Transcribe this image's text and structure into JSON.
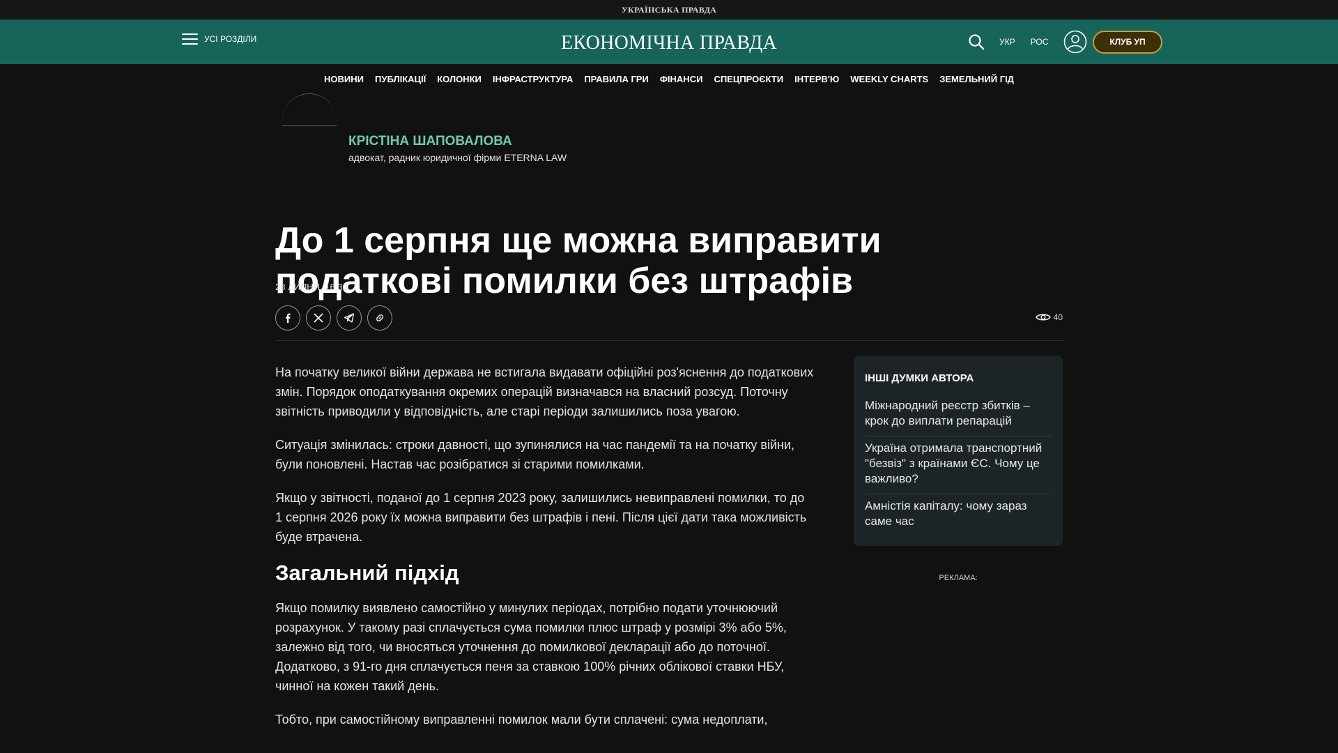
{
  "topbar": {
    "brand": "УКРАЇНСЬКА ПРАВДА"
  },
  "header": {
    "menu_label": "УСІ РОЗДІЛИ",
    "logo": "ЕКОНОМІЧНА ПРАВДА",
    "lang_ukr": "УКР",
    "lang_ros": "РОС",
    "club_label": "КЛУБ УП"
  },
  "nav": {
    "items": [
      "НОВИНИ",
      "ПУБЛІКАЦІЇ",
      "КОЛОНКИ",
      "ІНФРАСТРУКТУРА",
      "ПРАВИЛА ГРИ",
      "ФІНАНСИ",
      "СПЕЦПРОЄКТИ",
      "ІНТЕРВ'Ю",
      "WEEKLY CHARTS",
      "ЗЕМЕЛЬНИЙ ГІД"
    ]
  },
  "author": {
    "name": "КРІСТІНА ШАПОВАЛОВА",
    "role": "адвокат, радник юридичної фірми ETERNA LAW"
  },
  "article": {
    "title": "До 1 серпня ще можна виправити податкові помилки без штрафів",
    "date": "28 ЛИПНЯ, 16:30",
    "views": "40",
    "p1": "На початку великої війни держава не встигала видавати офіційні роз'яснення до податкових змін. Порядок оподаткування окремих операцій визначався на власний розсуд. Поточну звітність приводили у відповідність, але старі періоди залишились поза увагою.",
    "p2": "Ситуація змінилась: строки давності, що зупинялися на час пандемії та на початку війни, були поновлені. Настав час розібратися зі старими помилками.",
    "p3": "Якщо у звітності, поданої до 1 серпня 2023 року, залишились невиправлені помилки, то до 1 серпня 2026 року їх можна виправити без штрафів і пені. Після цієї дати така можливість буде втрачена.",
    "h2": "Загальний підхід",
    "p4": "Якщо помилку виявлено самостійно у минулих періодах, потрібно подати уточнюючий розрахунок. У такому разі сплачується сума помилки плюс штраф у розмірі 3% або 5%, залежно від того, чи вносяться уточнення до помилкової декларації або до поточної. Додатково, з 91-го дня сплачується пеня за ставкою 100% річних облікової ставки НБУ, чинної на кожен такий день.",
    "p5": "Тобто, при самостійному виправленні помилок мали бути сплачені: сума недоплати,"
  },
  "sidebar": {
    "heading": "ІНШІ ДУМКИ АВТОРА",
    "items": [
      "Міжнародний реєстр збитків – крок до виплати репарацій",
      "Україна отримала транспортний \"безвіз\" з країнами ЄС. Чому це важливо?",
      "Амністія капіталу: чому зараз саме час"
    ],
    "ad_label": "РЕКЛАМА:"
  },
  "icons": {
    "share": [
      "facebook-icon",
      "x-icon",
      "telegram-icon",
      "link-icon"
    ],
    "views": "eye-icon"
  },
  "colors": {
    "header_bg": "#17645a",
    "author_name": "#6fc9b3",
    "club_border": "#bfa040",
    "page_bg": "#111111"
  }
}
